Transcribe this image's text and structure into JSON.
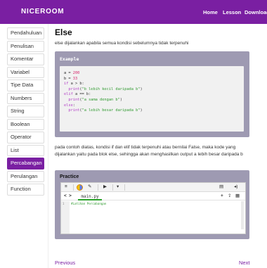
{
  "navbar": {
    "brand": "NICEROOM",
    "links": [
      "Home",
      "Lesson",
      "Download"
    ]
  },
  "sidebar": {
    "items": [
      {
        "label": "Pendahuluan",
        "active": false
      },
      {
        "label": "Penulisan",
        "active": false
      },
      {
        "label": "Komentar",
        "active": false
      },
      {
        "label": "Variabel",
        "active": false
      },
      {
        "label": "Tipe Data",
        "active": false
      },
      {
        "label": "Numbers",
        "active": false
      },
      {
        "label": "String",
        "active": false
      },
      {
        "label": "Boolean",
        "active": false
      },
      {
        "label": "Operator",
        "active": false
      },
      {
        "label": "List",
        "active": false
      },
      {
        "label": "Percabangan",
        "active": true
      },
      {
        "label": "Perulangan",
        "active": false
      },
      {
        "label": "Function",
        "active": false
      }
    ]
  },
  "content": {
    "title": "Else",
    "intro": "else dijalankan apabila semua kondisi sebelumnya tidak terpenuhi",
    "example_label": "Example",
    "code": {
      "l1_var": "a",
      "l1_op": " = ",
      "l1_num": "200",
      "l2_var": "b",
      "l2_op": " = ",
      "l2_num": "33",
      "l3_kw": "if",
      "l3_rest": " a > b:",
      "l4_fn": "print",
      "l4_open": "(",
      "l4_str": "\"b lebih kecil daripada b\"",
      "l4_close": ")",
      "l5_kw": "elif",
      "l5_rest": " a == b:",
      "l6_fn": "print",
      "l6_open": "(",
      "l6_str": "\"a sama dengan b\"",
      "l6_close": ")",
      "l7_kw": "else",
      "l7_rest": ":",
      "l8_fn": "print",
      "l8_open": "(",
      "l8_str": "\"a lebih besar daripada b\"",
      "l8_close": ")"
    },
    "explanation": "pada contoh diatas, kondisi if dan elif tidak terpenuhi atau bernilai False, maka kode yang dijalankan yaitu pada blok else, sehingga akan menghasilkan output a lebih besar daripada b",
    "practice_label": "Practice"
  },
  "ide": {
    "toolbar": {
      "menu_icon": "≡",
      "pencil_icon": "✎",
      "run_icon": "▶",
      "dropdown_icon": "▾",
      "save_icon": "▤",
      "sound_icon": "◂)"
    },
    "file_nav": {
      "prev_icon": "<",
      "next_icon": ">",
      "add_icon": "+",
      "upload_icon": "⇪",
      "file_icon": "▦"
    },
    "file_tab": "main.py",
    "editor": {
      "line_number": "1",
      "line_text": "#Latihan Percabangan"
    }
  },
  "pagination": {
    "prev": "Previous",
    "next": "Next"
  },
  "colors": {
    "accent": "#7a1fa2",
    "panel": "#9e9ab2",
    "code_bg": "#f1f1f1"
  }
}
